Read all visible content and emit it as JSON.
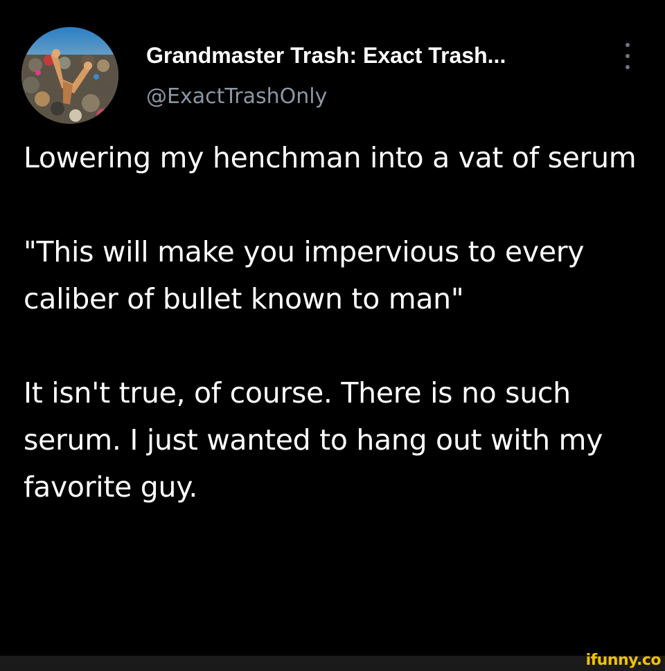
{
  "tweet": {
    "author": {
      "display_name": "Grandmaster Trash: Exact Trash...",
      "handle": "@ExactTrashOnly",
      "avatar_icon": "trash-pile-avatar"
    },
    "more_icon": "more-vertical-icon",
    "body": [
      "Lowering my henchman into a vat of serum",
      "\"This will make you impervious to every caliber of bullet known to man\"",
      "It isn't true, of course. There is no such serum. I just wanted to hang out with my favorite guy."
    ]
  },
  "watermark": {
    "text": "ifunny.co"
  },
  "colors": {
    "background": "#000000",
    "primary_text": "#ffffff",
    "secondary_text": "#8b98a5",
    "watermark": "#f2c200",
    "footer_bar": "#1a1a1a"
  }
}
